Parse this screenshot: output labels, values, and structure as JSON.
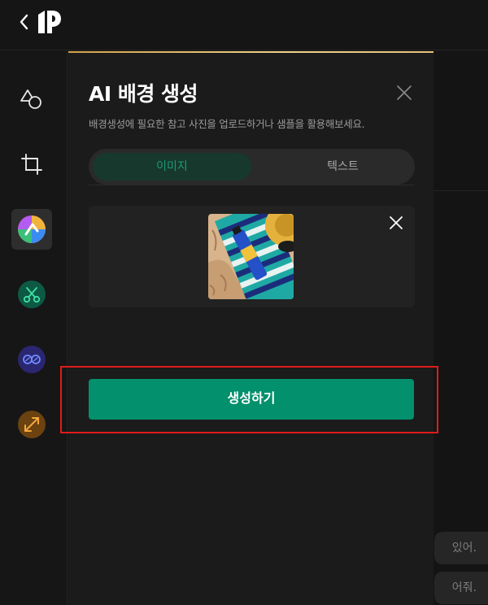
{
  "panel": {
    "title": "AI 배경 생성",
    "description": "배경생성에 필요한 참고 사진을 업로드하거나 샘플을 활용해보세요.",
    "tabs": [
      {
        "label": "이미지",
        "active": true
      },
      {
        "label": "텍스트",
        "active": false
      }
    ],
    "generate_label": "생성하기"
  },
  "chat": {
    "messages": [
      "있어.",
      "어줘."
    ]
  },
  "rail": {
    "tools": [
      "shapes-icon",
      "crop-icon",
      "ai-background-icon",
      "cutout-icon",
      "filter-icon",
      "resize-icon"
    ]
  },
  "colors": {
    "accent_green": "#03906c",
    "tab_active_text": "#1a9b74",
    "highlight_red": "#e01b1b"
  }
}
